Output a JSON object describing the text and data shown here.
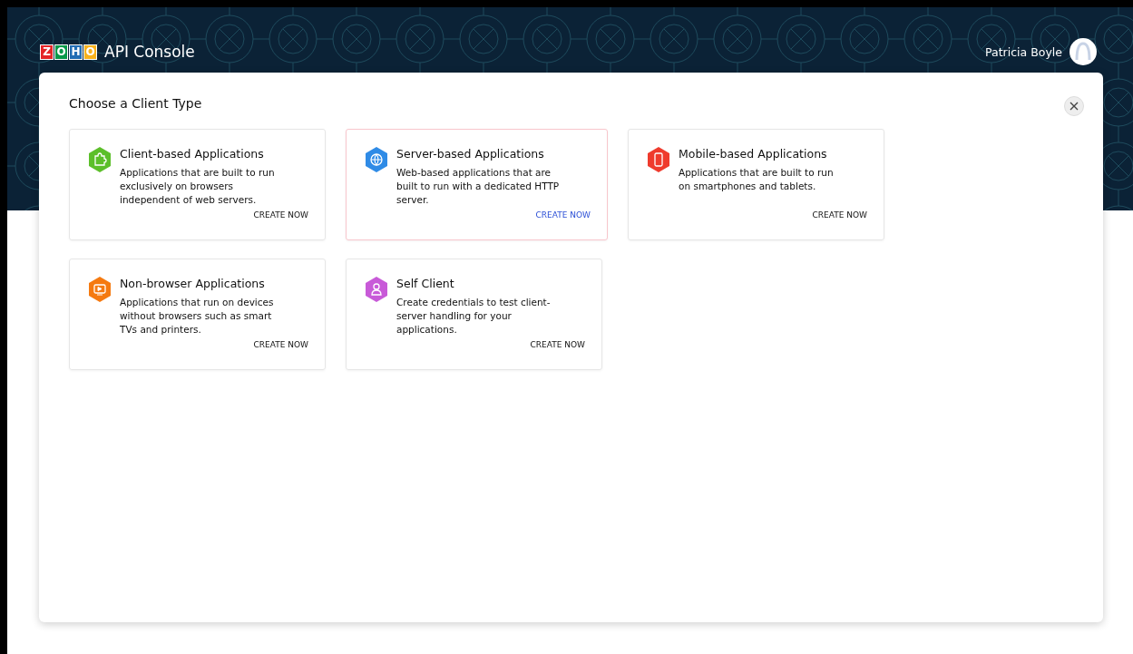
{
  "header": {
    "logo_letters": [
      "Z",
      "O",
      "H",
      "O"
    ],
    "title": "API Console",
    "user": "Patricia Boyle"
  },
  "dialog": {
    "title": "Choose a Client Type",
    "cards": [
      {
        "kind": "puzzle",
        "color": "#5cbf2a",
        "title": "Client-based Applications",
        "description": "Applications that are built to run exclusively on browsers independent of web servers.",
        "action": "CREATE NOW",
        "selected": false
      },
      {
        "kind": "globe",
        "color": "#2f8be6",
        "title": "Server-based Applications",
        "description": "Web-based applications that are built to run with a dedicated HTTP server.",
        "action": "CREATE NOW",
        "selected": true
      },
      {
        "kind": "phone",
        "color": "#ef3b2d",
        "title": "Mobile-based Applications",
        "description": "Applications that are built to run on smartphones and tablets.",
        "action": "CREATE NOW",
        "selected": false
      },
      {
        "kind": "screen",
        "color": "#f57a10",
        "title": "Non-browser Applications",
        "description": "Applications that run on devices without browsers such as smart TVs and printers.",
        "action": "CREATE NOW",
        "selected": false
      },
      {
        "kind": "person",
        "color": "#c85ad8",
        "title": "Self Client",
        "description": "Create credentials to test client-server handling for your applications.",
        "action": "CREATE NOW",
        "selected": false
      }
    ]
  }
}
